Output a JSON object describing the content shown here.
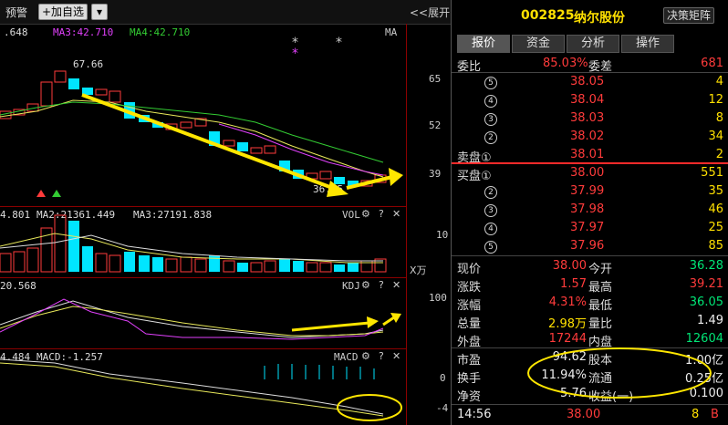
{
  "toolbar": {
    "alert_label": "预警",
    "add_watch_label": "+加自选",
    "expand_label": "<<展开"
  },
  "ma_legend": {
    "ma_first": ".648",
    "ma3": "MA3:42.710",
    "ma4": "MA4:42.710",
    "ma_tag": "MA"
  },
  "price_axis": {
    "ticks": [
      "65",
      "52",
      "39"
    ],
    "high_marker": "67.66",
    "low_marker": "36.05"
  },
  "volume_panel": {
    "v1": "4.801",
    "ma2": "MA2:21361.449",
    "ma3": "MA3:27191.838",
    "name": "VOL",
    "tick": "10",
    "unit": "X万"
  },
  "kdj_panel": {
    "v1": "20.568",
    "name": "KDJ",
    "tick": "100"
  },
  "macd_panel": {
    "v1": "4.484",
    "macd": "MACD:-1.257",
    "name": "MACD",
    "ticks": [
      "0",
      "-4"
    ]
  },
  "header": {
    "code": "002825",
    "name": "纳尔股份",
    "decision_button": "决策矩阵"
  },
  "tabs": [
    "报价",
    "资金",
    "分析",
    "操作"
  ],
  "weibi": {
    "label": "委比",
    "value": "85.03%",
    "label2": "委差",
    "value2": "681"
  },
  "sell_orders": [
    {
      "level": "5",
      "price": "38.05",
      "vol": "4"
    },
    {
      "level": "4",
      "price": "38.04",
      "vol": "12"
    },
    {
      "level": "3",
      "price": "38.03",
      "vol": "8"
    },
    {
      "level": "2",
      "price": "38.02",
      "vol": "34"
    },
    {
      "level": "1",
      "label": "卖盘①",
      "price": "38.01",
      "vol": "2"
    }
  ],
  "buy_orders": [
    {
      "level": "1",
      "label": "买盘①",
      "price": "38.00",
      "vol": "551"
    },
    {
      "level": "2",
      "price": "37.99",
      "vol": "35"
    },
    {
      "level": "3",
      "price": "37.98",
      "vol": "46"
    },
    {
      "level": "4",
      "price": "37.97",
      "vol": "25"
    },
    {
      "level": "5",
      "price": "37.96",
      "vol": "85"
    }
  ],
  "stats": [
    {
      "l1": "现价",
      "v1": "38.00",
      "c1": "red",
      "l2": "今开",
      "v2": "36.28",
      "c2": "green"
    },
    {
      "l1": "涨跌",
      "v1": "1.57",
      "c1": "red",
      "l2": "最高",
      "v2": "39.21",
      "c2": "red"
    },
    {
      "l1": "涨幅",
      "v1": "4.31%",
      "c1": "red",
      "l2": "最低",
      "v2": "36.05",
      "c2": "green"
    },
    {
      "l1": "总量",
      "v1": "2.98万",
      "c1": "yellow",
      "l2": "量比",
      "v2": "1.49",
      "c2": "white"
    },
    {
      "l1": "外盘",
      "v1": "17244",
      "c1": "red",
      "l2": "内盘",
      "v2": "12604",
      "c2": "green"
    }
  ],
  "fundamentals": [
    {
      "l1": "市盈",
      "v1": "94.62",
      "l2": "股本",
      "v2": "1.00亿"
    },
    {
      "l1": "换手",
      "v1": "11.94%",
      "l2": "流通",
      "v2": "0.25亿"
    },
    {
      "l1": "净资",
      "v1": "5.76",
      "l2": "收益(一)",
      "v2": "0.100"
    }
  ],
  "tick": {
    "time": "14:56",
    "price": "38.00",
    "vol": "8",
    "side": "B"
  },
  "colors": {
    "up": "#ff3b3b",
    "down": "#00e5ff",
    "annotation": "#ffe600",
    "ma_yellow": "#e8e85a",
    "ma_green": "#33cc33"
  }
}
